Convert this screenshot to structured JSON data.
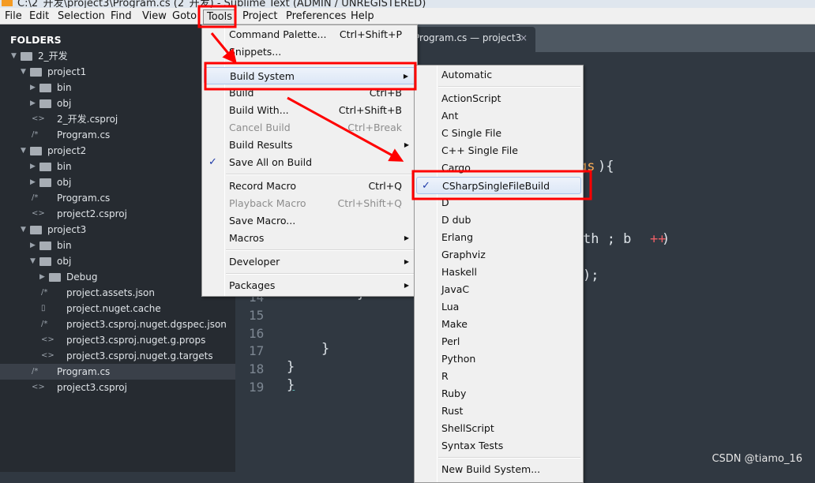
{
  "window": {
    "title": "C:\\2_开发\\project3\\Program.cs (2_开发) - Sublime Text (ADMIN / UNREGISTERED)"
  },
  "menubar": [
    "File",
    "Edit",
    "Selection",
    "Find",
    "View",
    "Goto",
    "Tools",
    "Project",
    "Preferences",
    "Help"
  ],
  "sidebar": {
    "header": "FOLDERS",
    "items": [
      {
        "label": "2_开发",
        "type": "folder",
        "open": true,
        "depth": 0
      },
      {
        "label": "project1",
        "type": "folder",
        "open": true,
        "depth": 1
      },
      {
        "label": "bin",
        "type": "folder",
        "open": false,
        "depth": 2
      },
      {
        "label": "obj",
        "type": "folder",
        "open": false,
        "depth": 2
      },
      {
        "label": "2_开发.csproj",
        "type": "file",
        "icon": "<>",
        "depth": 2
      },
      {
        "label": "Program.cs",
        "type": "file",
        "icon": "/*",
        "depth": 2
      },
      {
        "label": "project2",
        "type": "folder",
        "open": true,
        "depth": 1
      },
      {
        "label": "bin",
        "type": "folder",
        "open": false,
        "depth": 2
      },
      {
        "label": "obj",
        "type": "folder",
        "open": false,
        "depth": 2
      },
      {
        "label": "Program.cs",
        "type": "file",
        "icon": "/*",
        "depth": 2
      },
      {
        "label": "project2.csproj",
        "type": "file",
        "icon": "<>",
        "depth": 2
      },
      {
        "label": "project3",
        "type": "folder",
        "open": true,
        "depth": 1
      },
      {
        "label": "bin",
        "type": "folder",
        "open": false,
        "depth": 2
      },
      {
        "label": "obj",
        "type": "folder",
        "open": true,
        "depth": 2
      },
      {
        "label": "Debug",
        "type": "folder",
        "open": false,
        "depth": 3
      },
      {
        "label": "project.assets.json",
        "type": "file",
        "icon": "/*",
        "depth": 3
      },
      {
        "label": "project.nuget.cache",
        "type": "file",
        "icon": "▯",
        "depth": 3
      },
      {
        "label": "project3.csproj.nuget.dgspec.json",
        "type": "file",
        "icon": "/*",
        "depth": 3
      },
      {
        "label": "project3.csproj.nuget.g.props",
        "type": "file",
        "icon": "<>",
        "depth": 3
      },
      {
        "label": "project3.csproj.nuget.g.targets",
        "type": "file",
        "icon": "<>",
        "depth": 3
      },
      {
        "label": "Program.cs",
        "type": "file",
        "icon": "/*",
        "depth": 2,
        "selected": true
      },
      {
        "label": "project3.csproj",
        "type": "file",
        "icon": "<>",
        "depth": 2
      }
    ]
  },
  "tab": {
    "label": "Program.cs — project3",
    "close": "×"
  },
  "editor": {
    "line_numbers": [
      "14",
      "15",
      "16",
      "17",
      "18",
      "19"
    ],
    "fragments": [
      {
        "text": "gs",
        "color": "#f9ae58"
      },
      {
        "text": "){",
        "color": "#dde3e8"
      },
      {
        "text": "th ; b ",
        "color": "#dde3e8"
      },
      {
        "text": "++",
        "color": "#ec5f66"
      },
      {
        "text": ")",
        "color": "#dde3e8"
      },
      {
        "text": ");",
        "color": "#dde3e8"
      },
      {
        "text": "}",
        "color": "#dde3e8"
      },
      {
        "text": "}",
        "color": "#dde3e8"
      },
      {
        "text": "}",
        "color": "#dde3e8"
      },
      {
        "text": "}",
        "color": "#dde3e8"
      }
    ]
  },
  "tools_menu": [
    {
      "label": "Command Palette...",
      "shortcut": "Ctrl+Shift+P"
    },
    {
      "label": "Snippets..."
    },
    {
      "sep": true
    },
    {
      "label": "Build System",
      "submenu": true,
      "highlighted": true
    },
    {
      "label": "Build",
      "shortcut": "Ctrl+B"
    },
    {
      "label": "Build With...",
      "shortcut": "Ctrl+Shift+B"
    },
    {
      "label": "Cancel Build",
      "shortcut": "Ctrl+Break",
      "disabled": true
    },
    {
      "label": "Build Results",
      "submenu": true
    },
    {
      "label": "Save All on Build",
      "checked": true
    },
    {
      "sep": true
    },
    {
      "label": "Record Macro",
      "shortcut": "Ctrl+Q"
    },
    {
      "label": "Playback Macro",
      "shortcut": "Ctrl+Shift+Q",
      "disabled": true
    },
    {
      "label": "Save Macro..."
    },
    {
      "label": "Macros",
      "submenu": true
    },
    {
      "sep": true
    },
    {
      "label": "Developer",
      "submenu": true
    },
    {
      "sep": true
    },
    {
      "label": "Packages",
      "submenu": true
    }
  ],
  "build_system_menu": [
    {
      "label": "Automatic"
    },
    {
      "sep": true
    },
    {
      "label": "ActionScript"
    },
    {
      "label": "Ant"
    },
    {
      "label": "C Single File"
    },
    {
      "label": "C++ Single File"
    },
    {
      "label": "Cargo"
    },
    {
      "label": "CSharpSingleFileBuild",
      "checked": true,
      "highlighted": true
    },
    {
      "label": "D"
    },
    {
      "label": "D dub"
    },
    {
      "label": "Erlang"
    },
    {
      "label": "Graphviz"
    },
    {
      "label": "Haskell"
    },
    {
      "label": "JavaC"
    },
    {
      "label": "Lua"
    },
    {
      "label": "Make"
    },
    {
      "label": "Perl"
    },
    {
      "label": "Python"
    },
    {
      "label": "R"
    },
    {
      "label": "Ruby"
    },
    {
      "label": "Rust"
    },
    {
      "label": "ShellScript"
    },
    {
      "label": "Syntax Tests"
    },
    {
      "sep": true
    },
    {
      "label": "New Build System..."
    }
  ],
  "check_glyph": "✓",
  "submenu_glyph": "▶",
  "annotation_color": "#ff0000",
  "watermark": "CSDN @tiamo_16"
}
